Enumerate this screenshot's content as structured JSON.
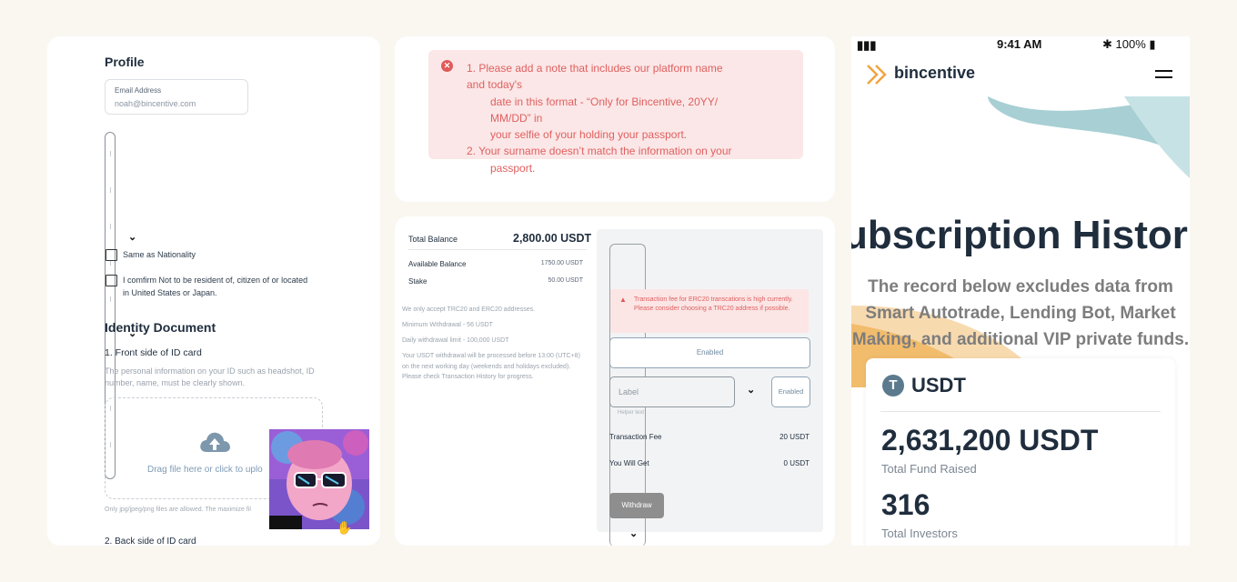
{
  "profile": {
    "title": "Profile",
    "email_label": "Email Address",
    "email_value": "noah@bincentive.com",
    "checkbox_nationality": "Same as Nationality",
    "checkbox_confirm_line1": "I comfirm Not to be resident of, citizen of or located",
    "checkbox_confirm_line2": "in United States or Japan.",
    "identity_title": "Identity Document",
    "front_title": "1. Front side of ID card",
    "front_desc": "The personal information on your ID such as headshot, ID number, name, must be clearly shown.",
    "drop_text": "Drag file here or click to uplo",
    "file_note": "Only jpg/jpeg/png files are allowed. The maximize fil",
    "back_title": "2. Back side of ID card"
  },
  "error_box": {
    "line1": "1.  Please add a note that includes our platform name and today's",
    "line2": "date in this format - “Only for Bincentive, 20YY/ MM/DD” in",
    "line3": "your selfie of your holding your passport.",
    "line4": "2.  Your surname doesn’t match the information on your",
    "line5": "passport."
  },
  "withdraw": {
    "total_balance_label": "Total Balance",
    "total_balance_value": "2,800.00 USDT",
    "available_label": "Available Balance",
    "available_value": "1750.00 USDT",
    "stake_label": "Stake",
    "stake_value": "50.00 USDT",
    "info1": "We only accept TRC20 and ERC20 addresses.",
    "info2": "Minimum Withdrawal - 56 USDT",
    "info3": "Daily withdrawal limit - 100,000 USDT",
    "info4": "Your USDT withdrawal will be processed before 13:00 (UTC+8) on the next working day (weekends and holidays excluded). Please check Transaction History for progress.",
    "warning": "Transaction fee for ERC20 transcations is high currently. Please consider choosing a TRC20 address if possible.",
    "enabled_wide": "Enabled",
    "label_placeholder": "Label",
    "enabled_small": "Enabled",
    "helper": "Helper text",
    "fee_label": "Transaction Fee",
    "fee_value": "20 USDT",
    "get_label": "You Will Get",
    "get_value": "0 USDT",
    "withdraw_btn": "Withdraw"
  },
  "mobile": {
    "time": "9:41 AM",
    "battery": "100%",
    "brand": "bincentive",
    "hero_title": "ubscription Histor",
    "hero_sub": "The record below excludes data from Smart Autotrade, Lending Bot, Market Making, and additional VIP private funds.",
    "coin": "USDT",
    "fund_value": "2,631,200 USDT",
    "fund_label": "Total Fund Raised",
    "investors_value": "316",
    "investors_label": "Total Investors",
    "colors": {
      "brand_orange": "#f0a540",
      "teal": "#a7cfd4",
      "navy": "#1f2d3d"
    }
  }
}
